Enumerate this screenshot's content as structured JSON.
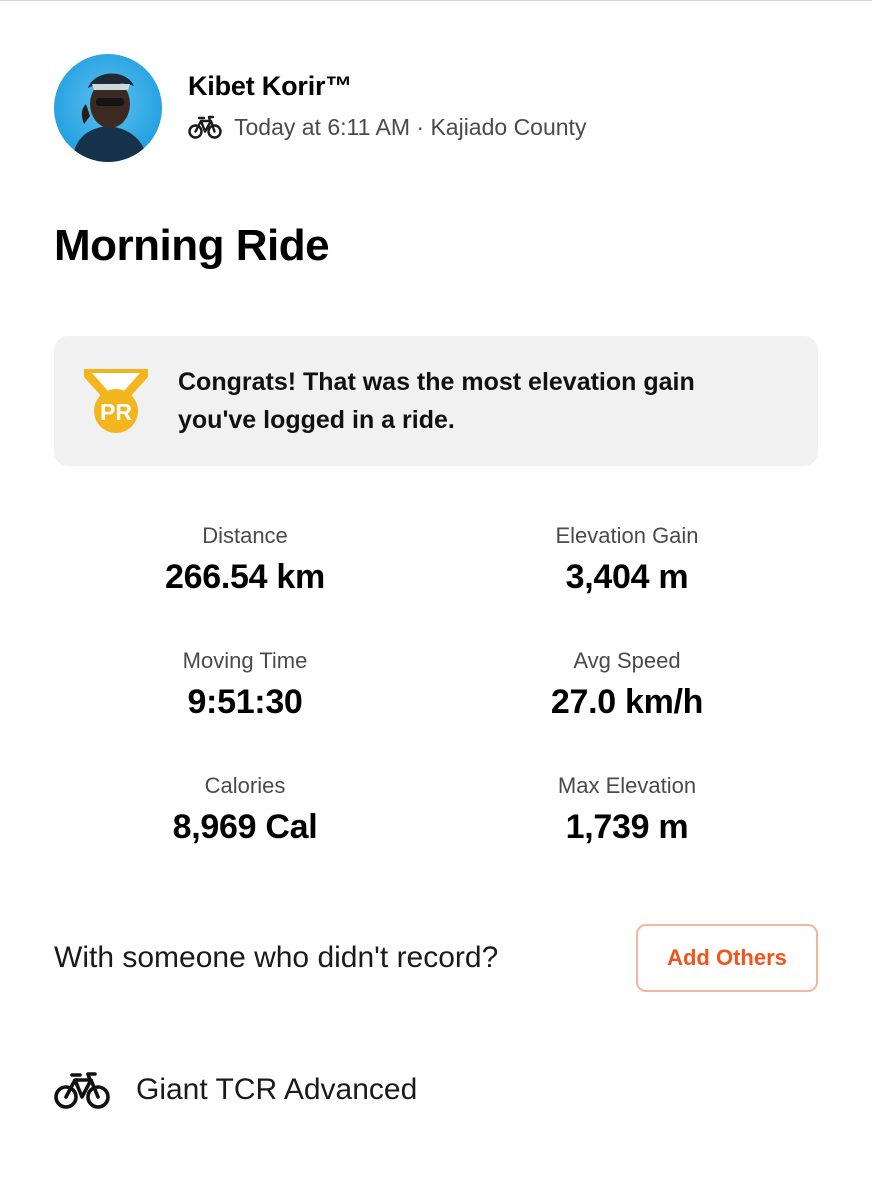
{
  "user": {
    "name": "Kibet Korir™",
    "activity_time": "Today at 6:11 AM · Kajiado County",
    "avatar_icon": "cyclist-avatar-photo",
    "sport_icon": "bike-icon"
  },
  "activity": {
    "title": "Morning Ride"
  },
  "pr_banner": {
    "icon": "pr-medal-icon",
    "badge_text": "PR",
    "message": "Congrats! That was the most elevation gain you've logged in a ride.",
    "accent_color": "#f2b51e"
  },
  "stats": [
    {
      "label": "Distance",
      "value": "266.54 km"
    },
    {
      "label": "Elevation Gain",
      "value": "3,404 m"
    },
    {
      "label": "Moving Time",
      "value": "9:51:30"
    },
    {
      "label": "Avg Speed",
      "value": "27.0 km/h"
    },
    {
      "label": "Calories",
      "value": "8,969 Cal"
    },
    {
      "label": "Max Elevation",
      "value": "1,739 m"
    }
  ],
  "with_others": {
    "prompt": "With someone who didn't record?",
    "button_label": "Add Others",
    "button_color": "#f2541b"
  },
  "gear": {
    "icon": "bike-icon",
    "name": "Giant TCR Advanced"
  }
}
